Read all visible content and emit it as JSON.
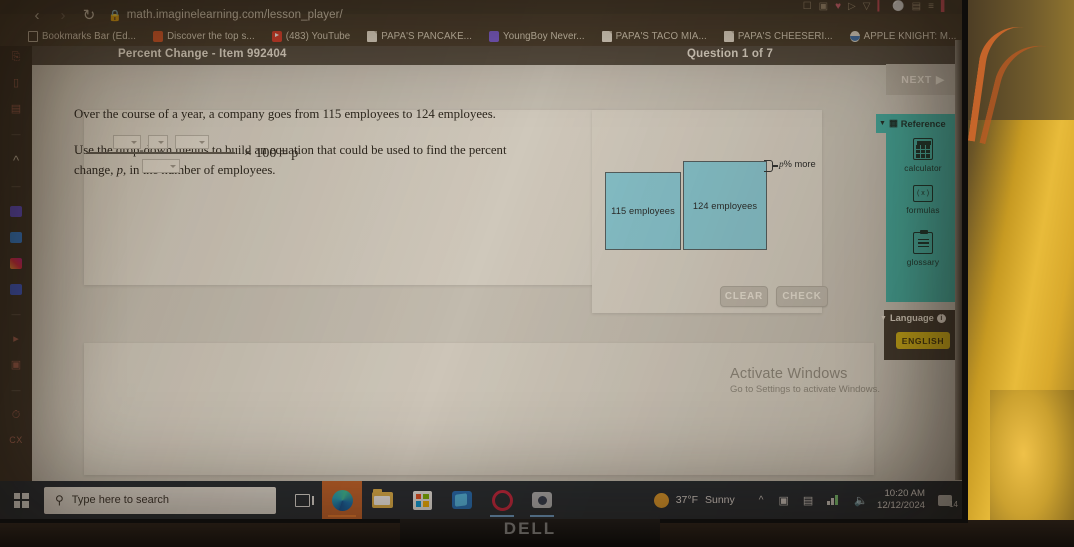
{
  "browser": {
    "url": "math.imaginelearning.com/lesson_player/",
    "back_icon": "back-arrow-icon",
    "forward_icon": "forward-arrow-icon",
    "reload_icon": "reload-icon",
    "lock_icon": "lock-icon",
    "bookmarks": [
      {
        "label": "Bookmarks Bar (Ed...",
        "icon": "folder-icon"
      },
      {
        "label": "Discover the top s...",
        "icon": "discover-icon"
      },
      {
        "label": "(483) YouTube",
        "icon": "youtube-icon"
      },
      {
        "label": "PAPA'S PANCAKE...",
        "icon": "document-icon"
      },
      {
        "label": "YoungBoy Never...",
        "icon": "flipboard-icon"
      },
      {
        "label": "PAPA'S TACO MIA...",
        "icon": "document-icon"
      },
      {
        "label": "PAPA'S CHEESERI...",
        "icon": "document-icon"
      },
      {
        "label": "APPLE KNIGHT: M...",
        "icon": "apple-knight-icon"
      }
    ]
  },
  "lesson": {
    "title": "Percent Change - Item 992404",
    "question_counter": "Question 1 of 7",
    "speaker_icon": "speaker-icon",
    "prompt_line1": "Over the course of a year, a company goes from 115 employees to 124 employees.",
    "prompt_line2_a": "Use the drop-down menus to build an equation that could be used to find the percent change, ",
    "prompt_variable": "p",
    "prompt_line2_b": ", in the number of employees."
  },
  "diagram": {
    "box_a_label": "115 employees",
    "box_b_label": "124 employees",
    "brace_label_var": "p",
    "brace_label_rest": "% more",
    "box_fill": "#87cfe0",
    "box_stroke": "#4f5d63"
  },
  "actions": {
    "clear_label": "CLEAR",
    "check_label": "CHECK"
  },
  "equation": {
    "numerator_dropdowns": [
      "",
      "",
      ""
    ],
    "denominator_dropdown": "",
    "tail": "× 100 = p",
    "dropdown_caret_icon": "chevron-down-icon"
  },
  "tools": {
    "next_label": "NEXT",
    "next_icon": "play-triangle-icon",
    "reference_header": "Reference",
    "reference_icon": "reference-icon",
    "items": [
      {
        "label": "calculator",
        "icon": "calculator-icon"
      },
      {
        "label": "formulas",
        "icon": "formulas-icon"
      },
      {
        "label": "glossary",
        "icon": "glossary-clipboard-icon"
      }
    ],
    "panel_color": "#3fb3ab",
    "language_header": "Language",
    "language_info_icon": "info-icon",
    "language_value": "ENGLISH",
    "language_button_color": "#d7b717",
    "collapse_icon": "caret-down-icon"
  },
  "watermark": {
    "title": "Activate Windows",
    "subtitle": "Go to Settings to activate Windows."
  },
  "taskbar": {
    "start_icon": "windows-start-icon",
    "search_placeholder": "Type here to search",
    "search_icon": "magnifier-icon",
    "apps": [
      {
        "name": "task-view",
        "icon": "task-view-icon"
      },
      {
        "name": "microsoft-edge",
        "icon": "edge-icon"
      },
      {
        "name": "file-explorer",
        "icon": "folder-icon"
      },
      {
        "name": "microsoft-store",
        "icon": "store-icon"
      },
      {
        "name": "outlook",
        "icon": "outlook-icon"
      },
      {
        "name": "opera",
        "icon": "opera-icon"
      },
      {
        "name": "camera",
        "icon": "camera-icon"
      }
    ],
    "weather_temp": "37°F",
    "weather_desc": "Sunny",
    "tray_chevron_icon": "chevron-up-icon",
    "tray_icons": [
      "onedrive-icon",
      "battery-icon",
      "wifi-icon",
      "volume-icon"
    ],
    "time": "10:20 AM",
    "date": "12/12/2024",
    "notification_count": "14",
    "notification_icon": "notification-icon"
  },
  "monitor": {
    "brand": "DELL"
  }
}
